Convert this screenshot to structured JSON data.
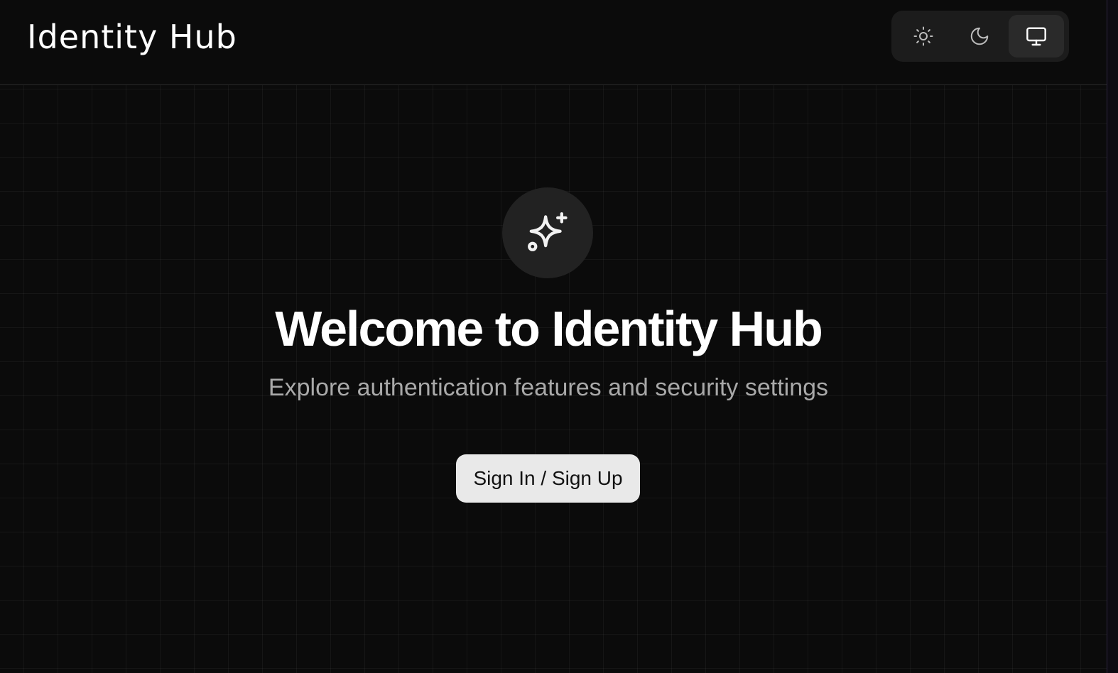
{
  "header": {
    "brand": "Identity Hub"
  },
  "theme_switcher": {
    "options": [
      {
        "name": "light",
        "icon": "sun-icon"
      },
      {
        "name": "dark",
        "icon": "moon-icon"
      },
      {
        "name": "system",
        "icon": "monitor-icon",
        "selected": true
      }
    ]
  },
  "hero": {
    "icon": "sparkles-icon",
    "title": "Welcome to Identity Hub",
    "subtitle": "Explore authentication features and security settings",
    "cta_label": "Sign In / Sign Up"
  },
  "colors": {
    "background": "#0b0b0b",
    "header_border": "#2a2a2a",
    "switch_bg": "#1c1c1c",
    "switch_selected": "#2a2a2a",
    "icon_circle": "#222222",
    "title": "#ffffff",
    "subtitle": "#a9a9a9",
    "cta_bg": "#e9e9e9",
    "cta_text": "#111111"
  }
}
